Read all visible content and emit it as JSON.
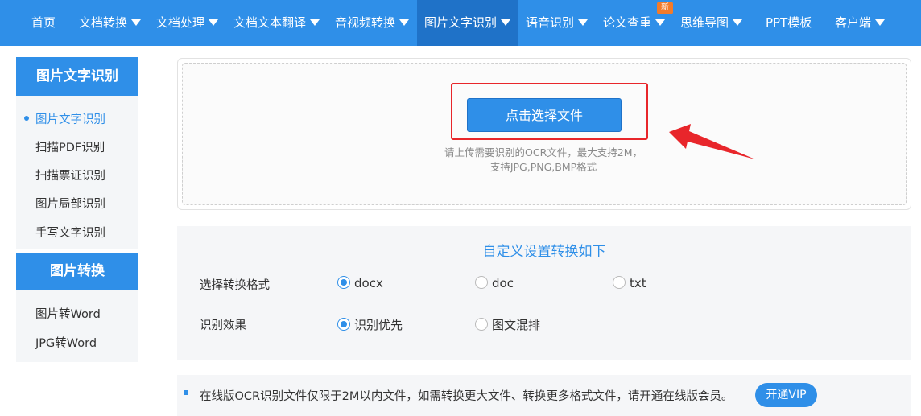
{
  "nav": {
    "items": [
      {
        "label": "首页",
        "dropdown": false
      },
      {
        "label": "文档转换",
        "dropdown": true
      },
      {
        "label": "文档处理",
        "dropdown": true
      },
      {
        "label": "文档文本翻译",
        "dropdown": true
      },
      {
        "label": "音视频转换",
        "dropdown": true
      },
      {
        "label": "图片文字识别",
        "dropdown": true,
        "active": true
      },
      {
        "label": "语音识别",
        "dropdown": true
      },
      {
        "label": "论文查重",
        "dropdown": true
      },
      {
        "label": "思维导图",
        "dropdown": true
      },
      {
        "label": "PPT模板",
        "dropdown": false
      },
      {
        "label": "客户端",
        "dropdown": true
      }
    ],
    "new_badge": "新"
  },
  "sidebar": {
    "group1_title": "图片文字识别",
    "group1_items": [
      "图片文字识别",
      "扫描PDF识别",
      "扫描票证识别",
      "图片局部识别",
      "手写文字识别"
    ],
    "group2_title": "图片转换",
    "group2_items": [
      "图片转Word",
      "JPG转Word"
    ]
  },
  "upload": {
    "button_label": "点击选择文件",
    "hint_line1": "请上传需要识别的OCR文件，最大支持2M，",
    "hint_line2": "支持JPG,PNG,BMP格式"
  },
  "settings": {
    "title": "自定义设置转换如下",
    "format_label": "选择转换格式",
    "format_options": [
      "docx",
      "doc",
      "txt"
    ],
    "format_selected": "docx",
    "effect_label": "识别效果",
    "effect_options": [
      "识别优先",
      "图文混排"
    ],
    "effect_selected": "识别优先"
  },
  "notice": {
    "text": "在线版OCR识别文件仅限于2M以内文件，如需转换更大文件、转换更多格式文件，请开通在线版会员。",
    "vip_button": "开通VIP"
  },
  "colors": {
    "primary": "#2f8fe8",
    "active_nav": "#1f72c8",
    "highlight": "#e8262b",
    "badge": "#f37b2a"
  }
}
